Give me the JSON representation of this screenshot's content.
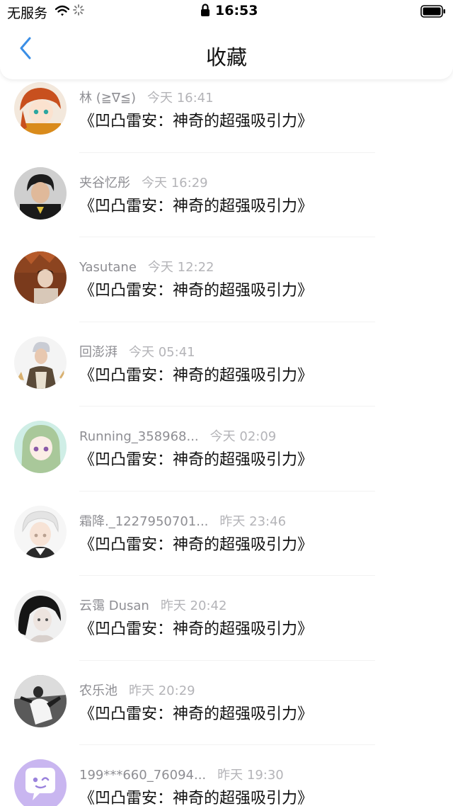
{
  "status_bar": {
    "carrier": "无服务",
    "time": "16:53"
  },
  "nav": {
    "title": "收藏",
    "back_icon": "chevron-left-icon",
    "accent_color": "#3a8ee6"
  },
  "colors": {
    "username": "#8e8e93",
    "timestamp": "#b4b4b8",
    "content": "#111111"
  },
  "items": [
    {
      "username": "林 (≧∇≦)",
      "time": "今天 16:41",
      "content": "《凹凸雷安：神奇的超强吸引力》"
    },
    {
      "username": "夹谷忆彤",
      "time": "今天 16:29",
      "content": "《凹凸雷安：神奇的超强吸引力》"
    },
    {
      "username": "Yasutane",
      "time": "今天 12:22",
      "content": "《凹凸雷安：神奇的超强吸引力》"
    },
    {
      "username": "回澎湃",
      "time": "今天 05:41",
      "content": "《凹凸雷安：神奇的超强吸引力》"
    },
    {
      "username": "Running_358968...",
      "time": "今天 02:09",
      "content": "《凹凸雷安：神奇的超强吸引力》"
    },
    {
      "username": "霜降._1227950701...",
      "time": "昨天 23:46",
      "content": "《凹凸雷安：神奇的超强吸引力》"
    },
    {
      "username": "云霭 Dusan",
      "time": "昨天 20:42",
      "content": "《凹凸雷安：神奇的超强吸引力》"
    },
    {
      "username": "农乐池",
      "time": "昨天 20:29",
      "content": "《凹凸雷安：神奇的超强吸引力》"
    },
    {
      "username": "199***660_76094...",
      "time": "昨天 19:30",
      "content": "《凹凸雷安：神奇的超强吸引力》"
    }
  ]
}
